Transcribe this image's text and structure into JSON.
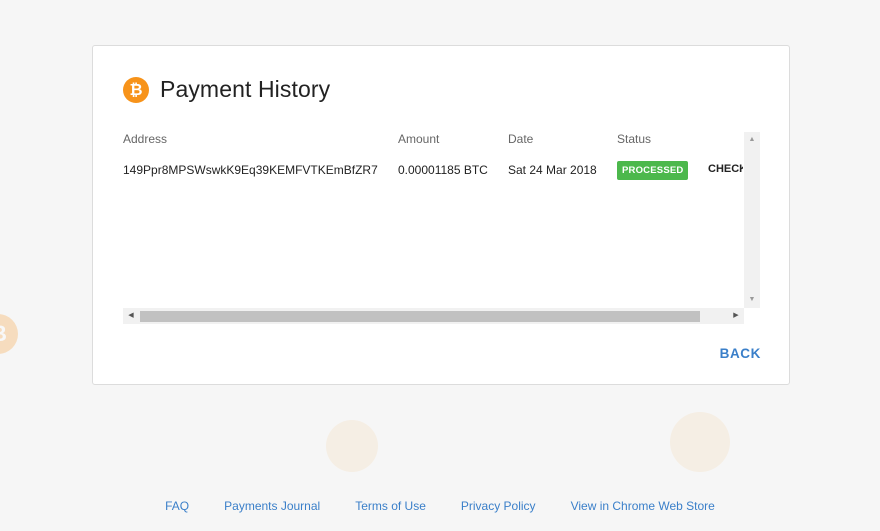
{
  "header": {
    "title": "Payment History",
    "logo_icon": "bitcoin-icon",
    "logo_glyph": "₿"
  },
  "table": {
    "columns": [
      "Address",
      "Amount",
      "Date",
      "Status"
    ],
    "rows": [
      {
        "address": "149Ppr8MPSWswkK9Eq39KEMFVTKEmBfZR7",
        "amount": "0.00001185 BTC",
        "date": "Sat 24 Mar 2018",
        "status": "PROCESSED",
        "action": "CHECK"
      }
    ]
  },
  "back_label": "BACK",
  "footer": {
    "links": [
      "FAQ",
      "Payments Journal",
      "Terms of Use",
      "Privacy Policy",
      "View in Chrome Web Store"
    ]
  },
  "colors": {
    "accent": "#3a7fc9",
    "bitcoin": "#f7931a",
    "status_ok": "#4cb84c"
  }
}
